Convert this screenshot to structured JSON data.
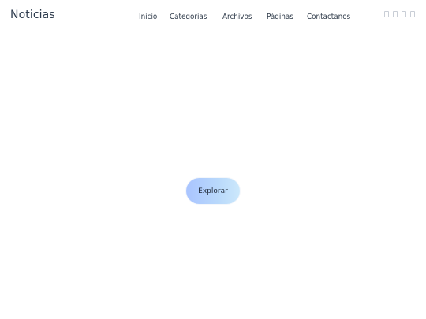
{
  "header": {
    "brand": "Noticias",
    "nav": {
      "items": [
        {
          "label": "Inicio"
        },
        {
          "label": "Categorias"
        },
        {
          "label": "Archivos"
        },
        {
          "label": "Páginas"
        },
        {
          "label": "Contactanos"
        }
      ]
    },
    "social_icons": [
      "social-icon-1",
      "social-icon-2",
      "social-icon-3",
      "social-icon-4"
    ]
  },
  "main": {
    "cta_label": "Explorar"
  },
  "colors": {
    "background": "#ffffff",
    "text": "#2f3b4a",
    "button_gradient_start": "#a9c4ff",
    "button_gradient_end": "#cce8fb"
  }
}
